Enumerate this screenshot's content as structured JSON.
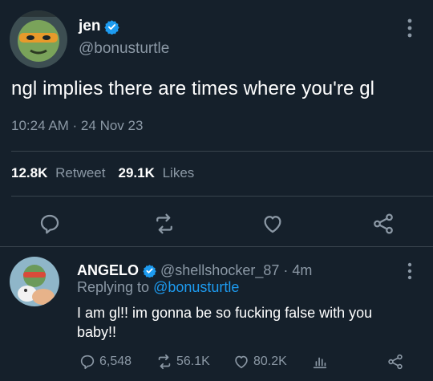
{
  "tweet": {
    "author_name": "jen",
    "author_handle": "@bonusturtle",
    "text": "ngl implies there are times where you're gl",
    "timestamp": "10:24 AM · 24 Nov 23",
    "retweets_count": "12.8K",
    "retweets_label": "Retweet",
    "likes_count": "29.1K",
    "likes_label": "Likes",
    "verified_icon": "verified-badge-icon"
  },
  "reply": {
    "author_name": "ANGELO",
    "author_handle": "@shellshocker_87",
    "age": "· 4m",
    "replying_prefix": "Replying to",
    "replying_to": "@bonusturtle",
    "text": "I am gl!! im gonna be so fucking false with you baby!!",
    "replies_count": "6,548",
    "retweets_count": "56.1K",
    "likes_count": "80.2K"
  },
  "colors": {
    "background": "#15202b",
    "secondary_text": "#8b98a5",
    "accent": "#1d9bf0",
    "divider": "#38444d"
  }
}
